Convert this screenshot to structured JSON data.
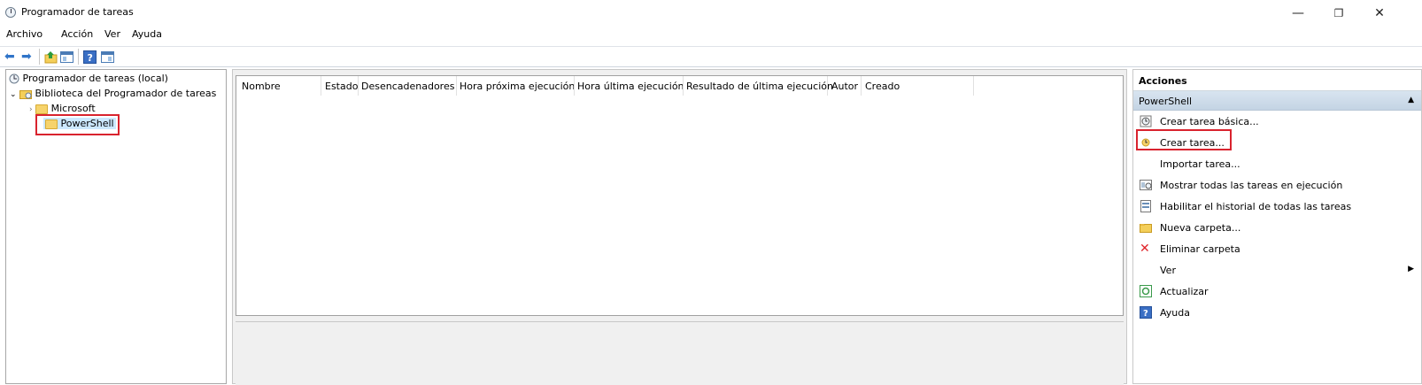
{
  "window": {
    "title": "Programador de tareas",
    "minimize": "—",
    "restore": "❐",
    "close": "✕"
  },
  "menu": [
    "Archivo",
    "Acción",
    "Ver",
    "Ayuda"
  ],
  "tree": {
    "root": "Programador de tareas (local)",
    "library": "Biblioteca del Programador de tareas",
    "children": [
      "Microsoft",
      "PowerShell"
    ],
    "selected": "PowerShell"
  },
  "table": {
    "columns": [
      "Nombre",
      "Estado",
      "Desencadenadores",
      "Hora próxima ejecución",
      "Hora última ejecución",
      "Resultado de última ejecución",
      "Autor",
      "Creado"
    ]
  },
  "actions": {
    "header": "Acciones",
    "section": "PowerShell",
    "items": [
      {
        "label": "Crear tarea básica...",
        "icon": "basic-task-icon"
      },
      {
        "label": "Crear tarea...",
        "icon": "create-task-icon"
      },
      {
        "label": "Importar tarea...",
        "icon": ""
      },
      {
        "label": "Mostrar todas las tareas en ejecución",
        "icon": "running-tasks-icon"
      },
      {
        "label": "Habilitar el historial de todas las tareas",
        "icon": "history-icon"
      },
      {
        "label": "Nueva carpeta...",
        "icon": "new-folder-icon"
      },
      {
        "label": "Eliminar carpeta",
        "icon": "delete-icon"
      },
      {
        "label": "Ver",
        "icon": ""
      },
      {
        "label": "Actualizar",
        "icon": "refresh-icon"
      },
      {
        "label": "Ayuda",
        "icon": "help-icon"
      }
    ]
  },
  "colors": {
    "accent": "#2f74c8",
    "highlight_border": "#d9232e",
    "section_bg": "#c8d8e8",
    "delete_red": "#e0242a"
  }
}
